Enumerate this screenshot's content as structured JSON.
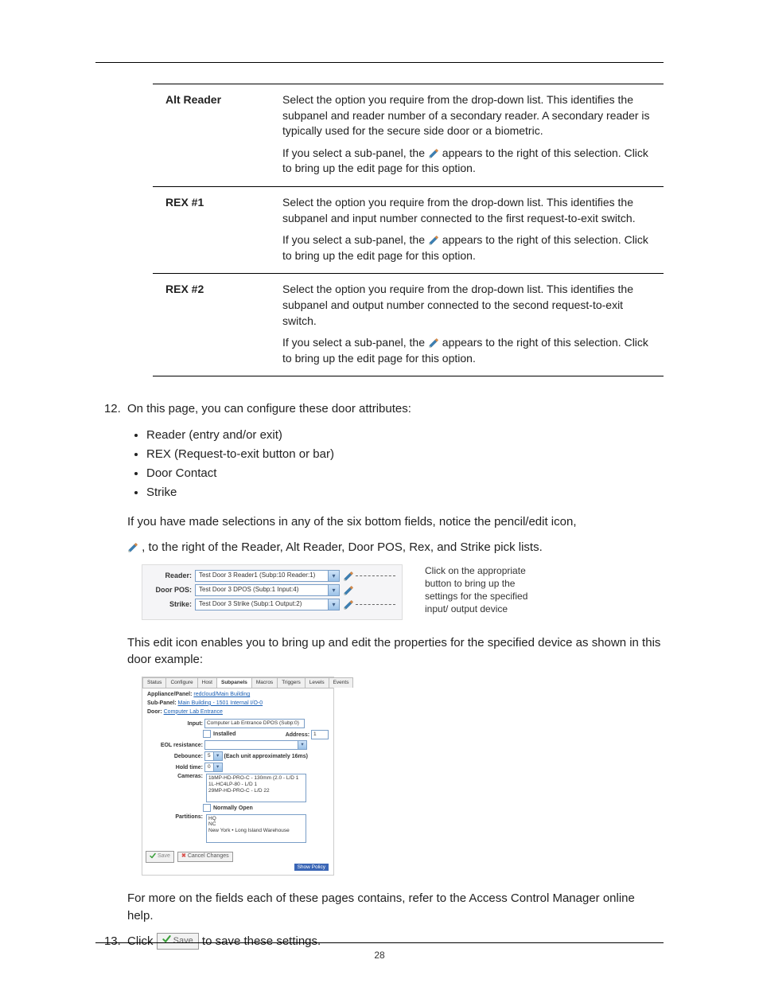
{
  "pageNumber": "28",
  "table": {
    "rows": [
      {
        "header": "Alt Reader",
        "p1": "Select the option you require from the drop-down list. This identifies the subpanel and reader number of a secondary reader. A secondary reader is typically used for the secure side door or a biometric.",
        "p2a": "If you select a sub-panel, the ",
        "p2b": " appears to the right of this selection. Click to bring up the edit page for this option."
      },
      {
        "header": "REX #1",
        "p1": "Select the option you require from the drop-down list. This identifies the subpanel and input number connected to the first request-to-exit switch.",
        "p2a": "If you select a sub-panel, the ",
        "p2b": " appears to the right of this selection. Click to bring up the edit page for this option."
      },
      {
        "header": "REX #2",
        "p1": "Select the option you require from the drop-down list. This identifies the subpanel and output number connected to the second request-to-exit switch.",
        "p2a": "If you select a sub-panel, the ",
        "p2b": " appears to the right of this selection. Click to bring up the edit page for this option."
      }
    ]
  },
  "step12": {
    "lead": "On this page, you can configure these door attributes:",
    "bullets": [
      "Reader (entry and/or exit)",
      "REX (Request-to-exit button or bar)",
      "Door Contact",
      "Strike"
    ],
    "afterBullets": "If you have made selections in any of the six bottom fields, notice the pencil/edit icon,",
    "afterPencil": ", to the right of the Reader, Alt Reader, Door POS, Rex, and Strike pick lists."
  },
  "uiSnippet1": {
    "rows": [
      {
        "label": "Reader:",
        "value": "Test Door 3 Reader1 (Subp:10 Reader:1)"
      },
      {
        "label": "Door POS:",
        "value": "Test Door 3 DPOS (Subp:1 Input:4)"
      },
      {
        "label": "Strike:",
        "value": "Test Door 3 Strike (Subp:1 Output:2)"
      }
    ],
    "callout": "Click on the appropriate button to bring up the settings for the specified input/ output device"
  },
  "afterSnippet1": "This edit icon enables you to bring up and edit the properties for the specified device as shown in this door example:",
  "uiSnippet2": {
    "tabs": [
      "Status",
      "Configure",
      "Host",
      "Subpanels",
      "Macros",
      "Triggers",
      "Levels",
      "Events"
    ],
    "activeTab": 3,
    "appliancePanelLabel": "Appliance/Panel:",
    "appliancePanelValue": "redcloud/Main Building",
    "subPanelLabel": "Sub-Panel:",
    "subPanelValue": "Main Building - 1501 Internal I/O-0",
    "doorLabel": "Door:",
    "doorValue": "Computer Lab Entrance",
    "inputLabel": "Input:",
    "inputValue": "Computer Lab Entrance DPOS (Subp:0)",
    "installedLabel": "Installed",
    "addressLabel": "Address:",
    "addressValue": "1",
    "eolLabel": "EOL resistance:",
    "debounceLabel": "Debounce:",
    "debounceValue": "5",
    "debounceHint": "(Each unit approximately 16ms)",
    "holdTimeLabel": "Hold time:",
    "holdTimeValue": "0",
    "camerasLabel": "Cameras:",
    "cameras": [
      "1bMP-HD-PRO-C - 130mm (2.0 - L/D 1",
      "1L-HC4LP-80 - L/D 1",
      "29MP-HD-PRO-C - L/D 22"
    ],
    "normallyOpenLabel": "Normally Open",
    "partitionsLabel": "Partitions:",
    "partitions": [
      "HQ",
      "NC",
      "New York • Long Island Warehouse"
    ],
    "saveBtn": "Save",
    "cancelBtn": "Cancel Changes",
    "policy": "Show Policy"
  },
  "afterSnippet2": "For more on the fields each of these pages contains, refer to the Access Control Manager online help.",
  "step13": {
    "pre": "Click ",
    "btn": "Save",
    "post": " to save these settings."
  }
}
